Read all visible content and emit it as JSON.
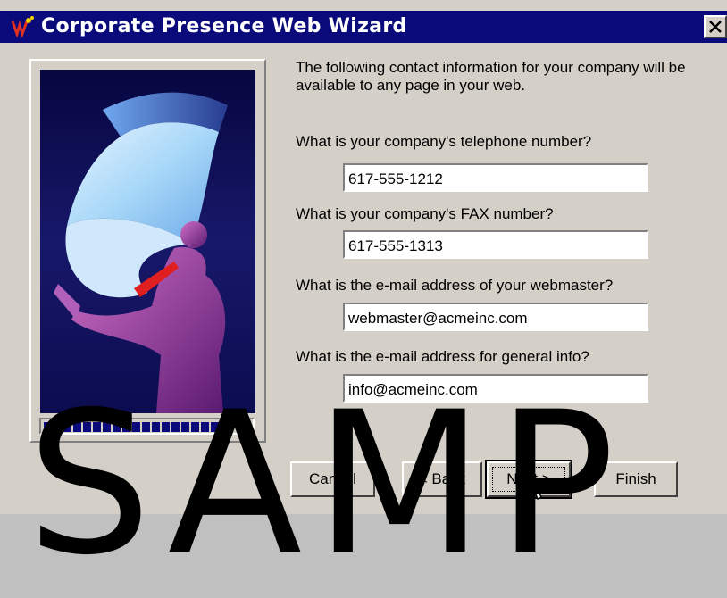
{
  "window": {
    "title": "Corporate Presence Web Wizard"
  },
  "intro_text": "The following contact information for your company will be available to any page in your web.",
  "fields": [
    {
      "label": "What is your company's telephone number?",
      "value": "617-555-1212"
    },
    {
      "label": "What is your company's FAX number?",
      "value": "617-555-1313"
    },
    {
      "label": "What is the e-mail address of your webmaster?",
      "value": "webmaster@acmeinc.com"
    },
    {
      "label": "What is the e-mail address for general info?",
      "value": "info@acmeinc.com"
    }
  ],
  "buttons": {
    "cancel": "Cancel",
    "back": "< Back",
    "next": "Next >",
    "finish": "Finish"
  },
  "progress": 0.86,
  "watermark": "SAMP",
  "colors": {
    "titlebar": "#0a0a7a",
    "face": "#d4d0c8"
  }
}
